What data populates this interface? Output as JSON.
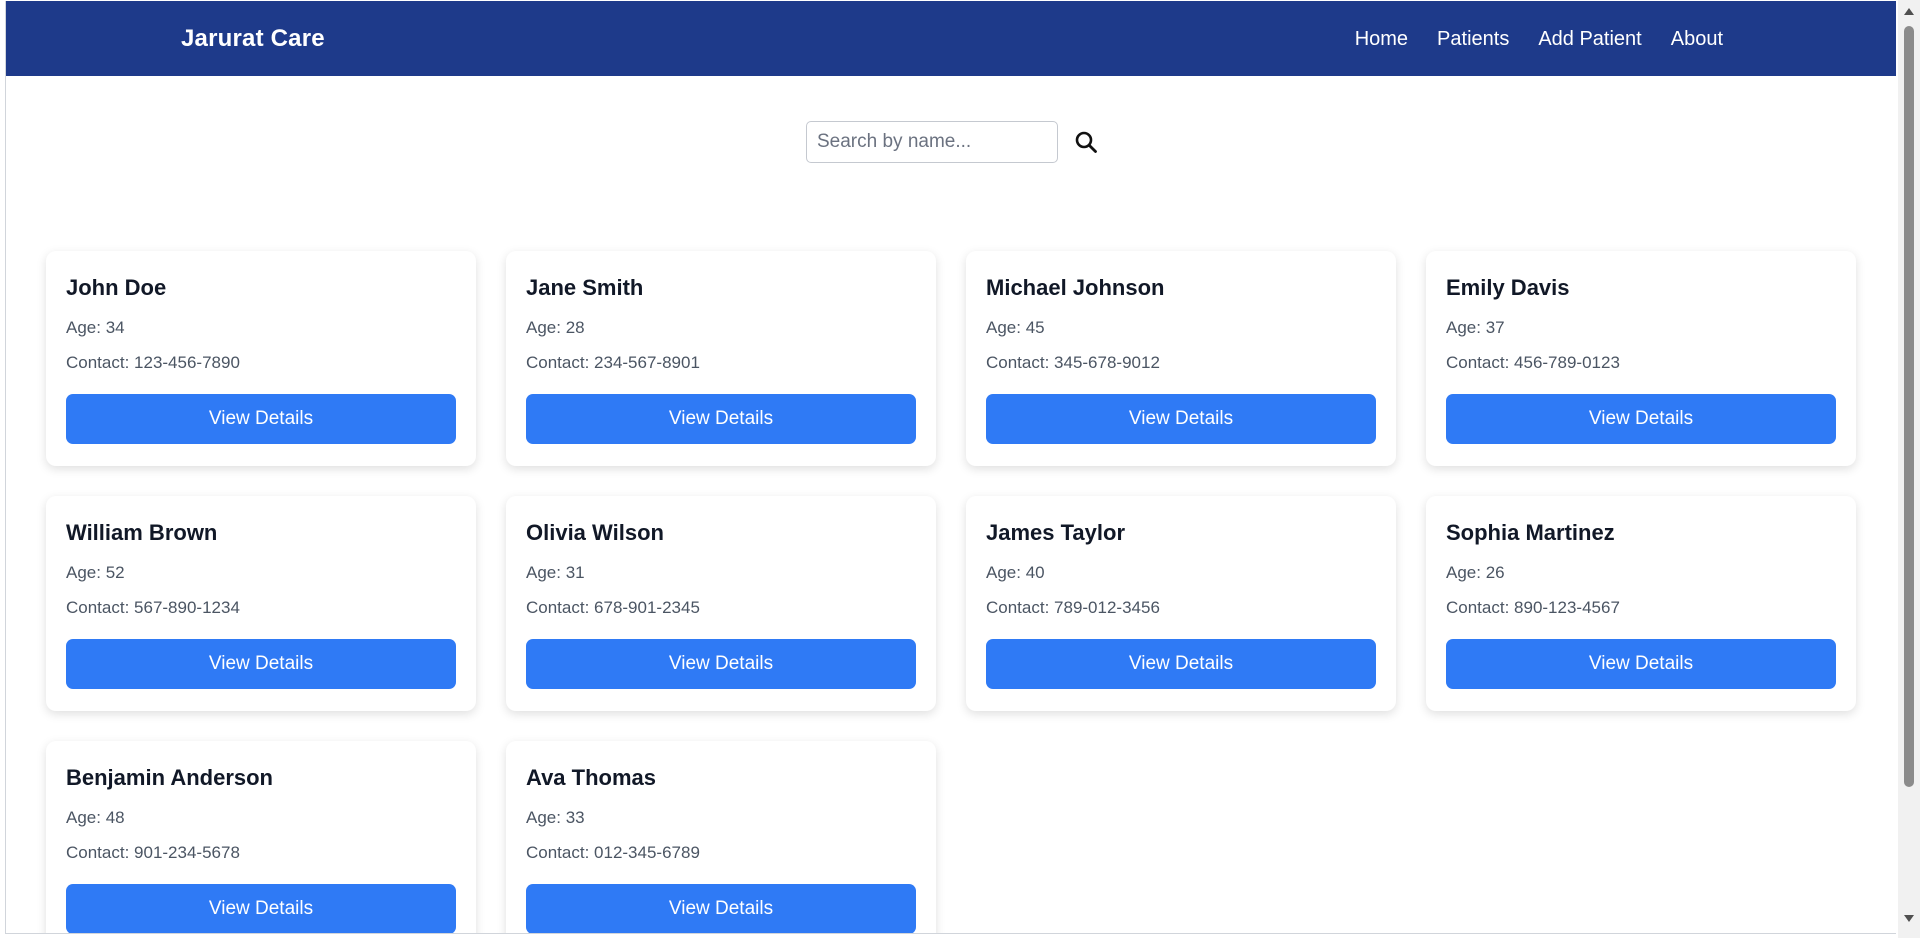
{
  "navbar": {
    "brand": "Jarurat Care",
    "links": [
      {
        "label": "Home"
      },
      {
        "label": "Patients"
      },
      {
        "label": "Add Patient"
      },
      {
        "label": "About"
      }
    ],
    "background": "#1e3a8a"
  },
  "search": {
    "placeholder": "Search by name...",
    "value": "",
    "icon": "search-icon"
  },
  "patients": [
    {
      "name": "John Doe",
      "age": "Age: 34",
      "contact": "Contact: 123-456-7890",
      "button": "View Details"
    },
    {
      "name": "Jane Smith",
      "age": "Age: 28",
      "contact": "Contact: 234-567-8901",
      "button": "View Details"
    },
    {
      "name": "Michael Johnson",
      "age": "Age: 45",
      "contact": "Contact: 345-678-9012",
      "button": "View Details"
    },
    {
      "name": "Emily Davis",
      "age": "Age: 37",
      "contact": "Contact: 456-789-0123",
      "button": "View Details"
    },
    {
      "name": "William Brown",
      "age": "Age: 52",
      "contact": "Contact: 567-890-1234",
      "button": "View Details"
    },
    {
      "name": "Olivia Wilson",
      "age": "Age: 31",
      "contact": "Contact: 678-901-2345",
      "button": "View Details"
    },
    {
      "name": "James Taylor",
      "age": "Age: 40",
      "contact": "Contact: 789-012-3456",
      "button": "View Details"
    },
    {
      "name": "Sophia Martinez",
      "age": "Age: 26",
      "contact": "Contact: 890-123-4567",
      "button": "View Details"
    },
    {
      "name": "Benjamin Anderson",
      "age": "Age: 48",
      "contact": "Contact: 901-234-5678",
      "button": "View Details"
    },
    {
      "name": "Ava Thomas",
      "age": "Age: 33",
      "contact": "Contact: 012-345-6789",
      "button": "View Details"
    }
  ],
  "colors": {
    "accent": "#2f7af5",
    "nav": "#1e3a8a"
  }
}
